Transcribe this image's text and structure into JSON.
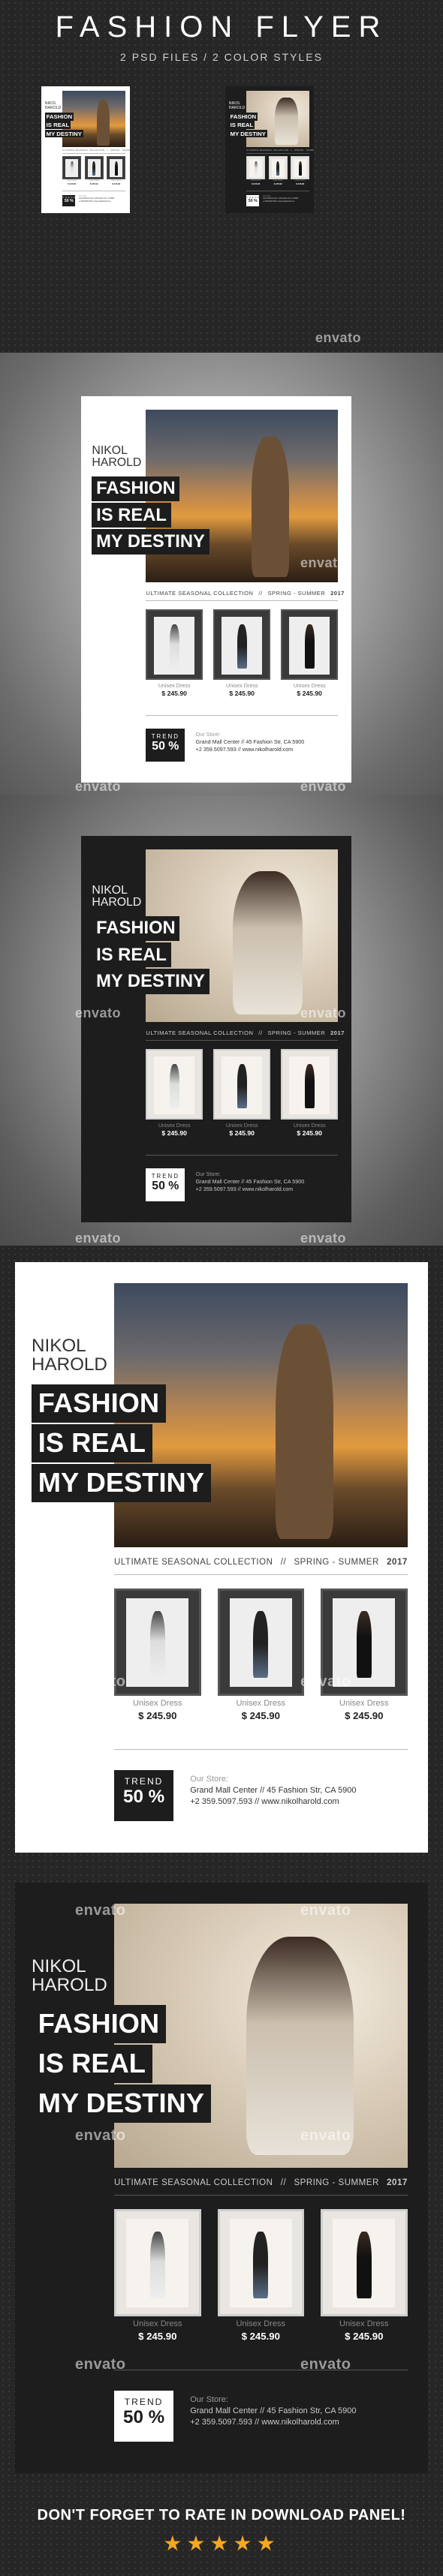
{
  "header": {
    "title": "FASHION FLYER",
    "subtitle": "2 PSD FILES / 2 COLOR STYLES"
  },
  "flyer": {
    "name_line1": "NIKOL",
    "name_line2": "HAROLD",
    "headline": [
      "FASHION",
      "IS REAL",
      "MY DESTINY"
    ],
    "collection": "ULTIMATE SEASONAL COLLECTION",
    "separator": "//",
    "season": "SPRING - SUMMER",
    "year": "2017",
    "products": [
      {
        "label": "Unisex Dress",
        "price": "$ 245.90"
      },
      {
        "label": "Unisex Dress",
        "price": "$ 245.90"
      },
      {
        "label": "Unisex Dress",
        "price": "$ 245.90"
      }
    ],
    "trend_label": "TREND",
    "trend_value": "50 %",
    "store_label": "Our Store:",
    "store_address": "Grand Mall Center  //  45 Fashion Str, CA 5900",
    "store_contact": "+2 359.5097.593  //  www.nikolharold.com"
  },
  "watermark": "envato",
  "footer": {
    "text": "DON'T FORGET TO RATE IN DOWNLOAD PANEL!",
    "stars": "★★★★★"
  },
  "colors": {
    "accent": "#f5a623",
    "dark": "#1d1d1d",
    "light": "#ffffff"
  }
}
